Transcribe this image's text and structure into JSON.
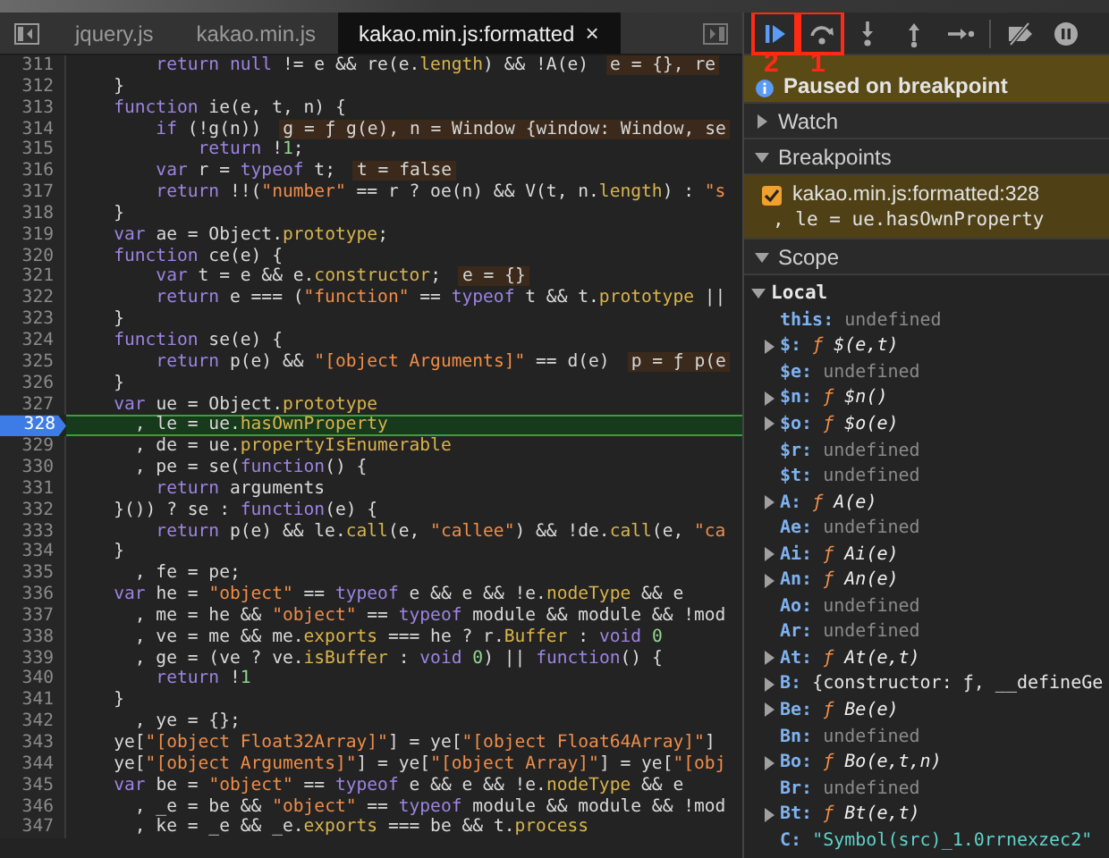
{
  "editor": {
    "tabs": [
      {
        "label": "jquery.js",
        "selected": false
      },
      {
        "label": "kakao.min.js",
        "selected": false
      },
      {
        "label": "kakao.min.js:formatted",
        "selected": true,
        "close": "×"
      }
    ],
    "lines": [
      {
        "number": "311",
        "current": false,
        "tokens": [
          {
            "kind": "kw",
            "text": "        return null"
          },
          {
            "kind": "plain",
            "text": " != e && re(e."
          },
          {
            "kind": "prop",
            "text": "length"
          },
          {
            "kind": "plain",
            "text": ") && !A(e)"
          },
          {
            "kind": "val",
            "text": "e = {}, re"
          }
        ]
      },
      {
        "number": "312",
        "current": false,
        "tokens": [
          {
            "kind": "plain",
            "text": "    }"
          }
        ]
      },
      {
        "number": "313",
        "current": false,
        "tokens": [
          {
            "kind": "kw",
            "text": "    function"
          },
          {
            "kind": "plain",
            "text": " ie(e, t, n) {"
          }
        ]
      },
      {
        "number": "314",
        "current": false,
        "tokens": [
          {
            "kind": "kw",
            "text": "        if"
          },
          {
            "kind": "plain",
            "text": " (!g(n))"
          },
          {
            "kind": "val",
            "text": "g = ƒ g(e), n = Window {window: Window, se"
          }
        ]
      },
      {
        "number": "315",
        "current": false,
        "tokens": [
          {
            "kind": "kw",
            "text": "            return"
          },
          {
            "kind": "plain",
            "text": " !"
          },
          {
            "kind": "num",
            "text": "1"
          },
          {
            "kind": "plain",
            "text": ";"
          }
        ]
      },
      {
        "number": "316",
        "current": false,
        "tokens": [
          {
            "kind": "kw",
            "text": "        var"
          },
          {
            "kind": "plain",
            "text": " r = "
          },
          {
            "kind": "kw",
            "text": "typeof"
          },
          {
            "kind": "plain",
            "text": " t;"
          },
          {
            "kind": "val",
            "text": "t = false"
          }
        ]
      },
      {
        "number": "317",
        "current": false,
        "tokens": [
          {
            "kind": "kw",
            "text": "        return"
          },
          {
            "kind": "plain",
            "text": " !!("
          },
          {
            "kind": "str",
            "text": "\"number\""
          },
          {
            "kind": "plain",
            "text": " == r ? oe(n) && V(t, n."
          },
          {
            "kind": "prop",
            "text": "length"
          },
          {
            "kind": "plain",
            "text": ") : "
          },
          {
            "kind": "str",
            "text": "\"s"
          }
        ]
      },
      {
        "number": "318",
        "current": false,
        "tokens": [
          {
            "kind": "plain",
            "text": "    }"
          }
        ]
      },
      {
        "number": "319",
        "current": false,
        "tokens": [
          {
            "kind": "kw",
            "text": "    var"
          },
          {
            "kind": "plain",
            "text": " ae = Object."
          },
          {
            "kind": "prop",
            "text": "prototype"
          },
          {
            "kind": "plain",
            "text": ";"
          }
        ]
      },
      {
        "number": "320",
        "current": false,
        "tokens": [
          {
            "kind": "kw",
            "text": "    function"
          },
          {
            "kind": "plain",
            "text": " ce(e) {"
          }
        ]
      },
      {
        "number": "321",
        "current": false,
        "tokens": [
          {
            "kind": "kw",
            "text": "        var"
          },
          {
            "kind": "plain",
            "text": " t = e && e."
          },
          {
            "kind": "prop",
            "text": "constructor"
          },
          {
            "kind": "plain",
            "text": ";"
          },
          {
            "kind": "val",
            "text": "e = {}"
          }
        ]
      },
      {
        "number": "322",
        "current": false,
        "tokens": [
          {
            "kind": "kw",
            "text": "        return"
          },
          {
            "kind": "plain",
            "text": " e === ("
          },
          {
            "kind": "str",
            "text": "\"function\""
          },
          {
            "kind": "plain",
            "text": " == "
          },
          {
            "kind": "kw",
            "text": "typeof"
          },
          {
            "kind": "plain",
            "text": " t && t."
          },
          {
            "kind": "prop",
            "text": "prototype"
          },
          {
            "kind": "plain",
            "text": " ||"
          }
        ]
      },
      {
        "number": "323",
        "current": false,
        "tokens": [
          {
            "kind": "plain",
            "text": "    }"
          }
        ]
      },
      {
        "number": "324",
        "current": false,
        "tokens": [
          {
            "kind": "kw",
            "text": "    function"
          },
          {
            "kind": "plain",
            "text": " se(e) {"
          }
        ]
      },
      {
        "number": "325",
        "current": false,
        "tokens": [
          {
            "kind": "kw",
            "text": "        return"
          },
          {
            "kind": "plain",
            "text": " p(e) && "
          },
          {
            "kind": "str",
            "text": "\"[object Arguments]\""
          },
          {
            "kind": "plain",
            "text": " == d(e)"
          },
          {
            "kind": "val",
            "text": "p = ƒ p(e"
          }
        ]
      },
      {
        "number": "326",
        "current": false,
        "tokens": [
          {
            "kind": "plain",
            "text": "    }"
          }
        ]
      },
      {
        "number": "327",
        "current": false,
        "tokens": [
          {
            "kind": "kw",
            "text": "    var"
          },
          {
            "kind": "plain",
            "text": " ue = Object."
          },
          {
            "kind": "prop",
            "text": "prototype"
          }
        ]
      },
      {
        "number": "328",
        "current": true,
        "tokens": [
          {
            "kind": "plain",
            "text": "      , le = ue."
          },
          {
            "kind": "prop",
            "text": "hasOwnProperty"
          }
        ]
      },
      {
        "number": "329",
        "current": false,
        "tokens": [
          {
            "kind": "plain",
            "text": "      , de = ue."
          },
          {
            "kind": "prop",
            "text": "propertyIsEnumerable"
          }
        ]
      },
      {
        "number": "330",
        "current": false,
        "tokens": [
          {
            "kind": "plain",
            "text": "      , pe = se("
          },
          {
            "kind": "kw",
            "text": "function"
          },
          {
            "kind": "plain",
            "text": "() {"
          }
        ]
      },
      {
        "number": "331",
        "current": false,
        "tokens": [
          {
            "kind": "kw",
            "text": "        return"
          },
          {
            "kind": "plain",
            "text": " arguments"
          }
        ]
      },
      {
        "number": "332",
        "current": false,
        "tokens": [
          {
            "kind": "plain",
            "text": "    }()) ? se : "
          },
          {
            "kind": "kw",
            "text": "function"
          },
          {
            "kind": "plain",
            "text": "(e) {"
          }
        ]
      },
      {
        "number": "333",
        "current": false,
        "tokens": [
          {
            "kind": "kw",
            "text": "        return"
          },
          {
            "kind": "plain",
            "text": " p(e) && le."
          },
          {
            "kind": "prop",
            "text": "call"
          },
          {
            "kind": "plain",
            "text": "(e, "
          },
          {
            "kind": "str",
            "text": "\"callee\""
          },
          {
            "kind": "plain",
            "text": ") && !de."
          },
          {
            "kind": "prop",
            "text": "call"
          },
          {
            "kind": "plain",
            "text": "(e, "
          },
          {
            "kind": "str",
            "text": "\"ca"
          }
        ]
      },
      {
        "number": "334",
        "current": false,
        "tokens": [
          {
            "kind": "plain",
            "text": "    }"
          }
        ]
      },
      {
        "number": "335",
        "current": false,
        "tokens": [
          {
            "kind": "plain",
            "text": "      , fe = pe;"
          }
        ]
      },
      {
        "number": "336",
        "current": false,
        "tokens": [
          {
            "kind": "kw",
            "text": "    var"
          },
          {
            "kind": "plain",
            "text": " he = "
          },
          {
            "kind": "str",
            "text": "\"object\""
          },
          {
            "kind": "plain",
            "text": " == "
          },
          {
            "kind": "kw",
            "text": "typeof"
          },
          {
            "kind": "plain",
            "text": " e && e && !e."
          },
          {
            "kind": "prop",
            "text": "nodeType"
          },
          {
            "kind": "plain",
            "text": " && e"
          }
        ]
      },
      {
        "number": "337",
        "current": false,
        "tokens": [
          {
            "kind": "plain",
            "text": "      , me = he && "
          },
          {
            "kind": "str",
            "text": "\"object\""
          },
          {
            "kind": "plain",
            "text": " == "
          },
          {
            "kind": "kw",
            "text": "typeof"
          },
          {
            "kind": "plain",
            "text": " module && module && !mod"
          }
        ]
      },
      {
        "number": "338",
        "current": false,
        "tokens": [
          {
            "kind": "plain",
            "text": "      , ve = me && me."
          },
          {
            "kind": "prop",
            "text": "exports"
          },
          {
            "kind": "plain",
            "text": " === he ? r."
          },
          {
            "kind": "prop",
            "text": "Buffer"
          },
          {
            "kind": "plain",
            "text": " : "
          },
          {
            "kind": "kw",
            "text": "void "
          },
          {
            "kind": "num",
            "text": "0"
          }
        ]
      },
      {
        "number": "339",
        "current": false,
        "tokens": [
          {
            "kind": "plain",
            "text": "      , ge = (ve ? ve."
          },
          {
            "kind": "prop",
            "text": "isBuffer"
          },
          {
            "kind": "plain",
            "text": " : "
          },
          {
            "kind": "kw",
            "text": "void "
          },
          {
            "kind": "num",
            "text": "0"
          },
          {
            "kind": "plain",
            "text": ") || "
          },
          {
            "kind": "kw",
            "text": "function"
          },
          {
            "kind": "plain",
            "text": "() {"
          }
        ]
      },
      {
        "number": "340",
        "current": false,
        "tokens": [
          {
            "kind": "kw",
            "text": "        return"
          },
          {
            "kind": "plain",
            "text": " !"
          },
          {
            "kind": "num",
            "text": "1"
          }
        ]
      },
      {
        "number": "341",
        "current": false,
        "tokens": [
          {
            "kind": "plain",
            "text": "    }"
          }
        ]
      },
      {
        "number": "342",
        "current": false,
        "tokens": [
          {
            "kind": "plain",
            "text": "      , ye = {};"
          }
        ]
      },
      {
        "number": "343",
        "current": false,
        "tokens": [
          {
            "kind": "plain",
            "text": "    ye["
          },
          {
            "kind": "str",
            "text": "\"[object Float32Array]\""
          },
          {
            "kind": "plain",
            "text": "] = ye["
          },
          {
            "kind": "str",
            "text": "\"[object Float64Array]\""
          },
          {
            "kind": "plain",
            "text": "]"
          }
        ]
      },
      {
        "number": "344",
        "current": false,
        "tokens": [
          {
            "kind": "plain",
            "text": "    ye["
          },
          {
            "kind": "str",
            "text": "\"[object Arguments]\""
          },
          {
            "kind": "plain",
            "text": "] = ye["
          },
          {
            "kind": "str",
            "text": "\"[object Array]\""
          },
          {
            "kind": "plain",
            "text": "] = ye["
          },
          {
            "kind": "str",
            "text": "\"[obj"
          }
        ]
      },
      {
        "number": "345",
        "current": false,
        "tokens": [
          {
            "kind": "kw",
            "text": "    var"
          },
          {
            "kind": "plain",
            "text": " be = "
          },
          {
            "kind": "str",
            "text": "\"object\""
          },
          {
            "kind": "plain",
            "text": " == "
          },
          {
            "kind": "kw",
            "text": "typeof"
          },
          {
            "kind": "plain",
            "text": " e && e && !e."
          },
          {
            "kind": "prop",
            "text": "nodeType"
          },
          {
            "kind": "plain",
            "text": " && e"
          }
        ]
      },
      {
        "number": "346",
        "current": false,
        "tokens": [
          {
            "kind": "plain",
            "text": "      , _e = be && "
          },
          {
            "kind": "str",
            "text": "\"object\""
          },
          {
            "kind": "plain",
            "text": " == "
          },
          {
            "kind": "kw",
            "text": "typeof"
          },
          {
            "kind": "plain",
            "text": " module && module && !mod"
          }
        ]
      },
      {
        "number": "347",
        "current": false,
        "tokens": [
          {
            "kind": "plain",
            "text": "      , ke = _e && _e."
          },
          {
            "kind": "prop",
            "text": "exports"
          },
          {
            "kind": "plain",
            "text": " === be && t."
          },
          {
            "kind": "prop",
            "text": "process"
          }
        ]
      }
    ]
  },
  "debugger": {
    "toolbar": [
      {
        "kind": "resume",
        "active": true,
        "annotation": "2"
      },
      {
        "kind": "step-over",
        "active": false,
        "annotation": "1"
      },
      {
        "kind": "step-into",
        "active": false
      },
      {
        "kind": "step-out",
        "active": false
      },
      {
        "kind": "step",
        "active": false
      },
      {
        "kind": "deactivate",
        "active": false
      },
      {
        "kind": "pause-exceptions",
        "active": false
      }
    ],
    "status": "Paused on breakpoint",
    "sections": [
      {
        "kind": "watch",
        "title": "Watch",
        "expanded": false
      },
      {
        "kind": "breakpoints",
        "title": "Breakpoints",
        "expanded": true,
        "items": [
          {
            "location": "kakao.min.js:formatted:328",
            "code": ", le = ue.hasOwnProperty",
            "checked": true
          }
        ]
      },
      {
        "kind": "scope",
        "title": "Scope",
        "expanded": true,
        "groups": [
          {
            "title": "Local",
            "expanded": true,
            "items": [
              {
                "name": "this:",
                "kind": "undefined",
                "value": "undefined",
                "expandable": false
              },
              {
                "name": "$:",
                "kind": "function",
                "prefix": "ƒ",
                "value": "$(e,t)",
                "expandable": true
              },
              {
                "name": "$e:",
                "kind": "undefined",
                "value": "undefined",
                "expandable": false
              },
              {
                "name": "$n:",
                "kind": "function",
                "prefix": "ƒ",
                "value": "$n()",
                "expandable": true
              },
              {
                "name": "$o:",
                "kind": "function",
                "prefix": "ƒ",
                "value": "$o(e)",
                "expandable": true
              },
              {
                "name": "$r:",
                "kind": "undefined",
                "value": "undefined",
                "expandable": false
              },
              {
                "name": "$t:",
                "kind": "undefined",
                "value": "undefined",
                "expandable": false
              },
              {
                "name": "A:",
                "kind": "function",
                "prefix": "ƒ",
                "value": "A(e)",
                "expandable": true
              },
              {
                "name": "Ae:",
                "kind": "undefined",
                "value": "undefined",
                "expandable": false
              },
              {
                "name": "Ai:",
                "kind": "function",
                "prefix": "ƒ",
                "value": "Ai(e)",
                "expandable": true
              },
              {
                "name": "An:",
                "kind": "function",
                "prefix": "ƒ",
                "value": "An(e)",
                "expandable": true
              },
              {
                "name": "Ao:",
                "kind": "undefined",
                "value": "undefined",
                "expandable": false
              },
              {
                "name": "Ar:",
                "kind": "undefined",
                "value": "undefined",
                "expandable": false
              },
              {
                "name": "At:",
                "kind": "function",
                "prefix": "ƒ",
                "value": "At(e,t)",
                "expandable": true
              },
              {
                "name": "B:",
                "kind": "object",
                "value": "{constructor: ƒ, __defineGe",
                "expandable": true
              },
              {
                "name": "Be:",
                "kind": "function",
                "prefix": "ƒ",
                "value": "Be(e)",
                "expandable": true
              },
              {
                "name": "Bn:",
                "kind": "undefined",
                "value": "undefined",
                "expandable": false
              },
              {
                "name": "Bo:",
                "kind": "function",
                "prefix": "ƒ",
                "value": "Bo(e,t,n)",
                "expandable": true
              },
              {
                "name": "Br:",
                "kind": "undefined",
                "value": "undefined",
                "expandable": false
              },
              {
                "name": "Bt:",
                "kind": "function",
                "prefix": "ƒ",
                "value": "Bt(e,t)",
                "expandable": true
              },
              {
                "name": "C:",
                "kind": "string",
                "value": "\"Symbol(src)_1.0rrnexzec2\"",
                "expandable": false
              }
            ]
          }
        ]
      }
    ]
  }
}
